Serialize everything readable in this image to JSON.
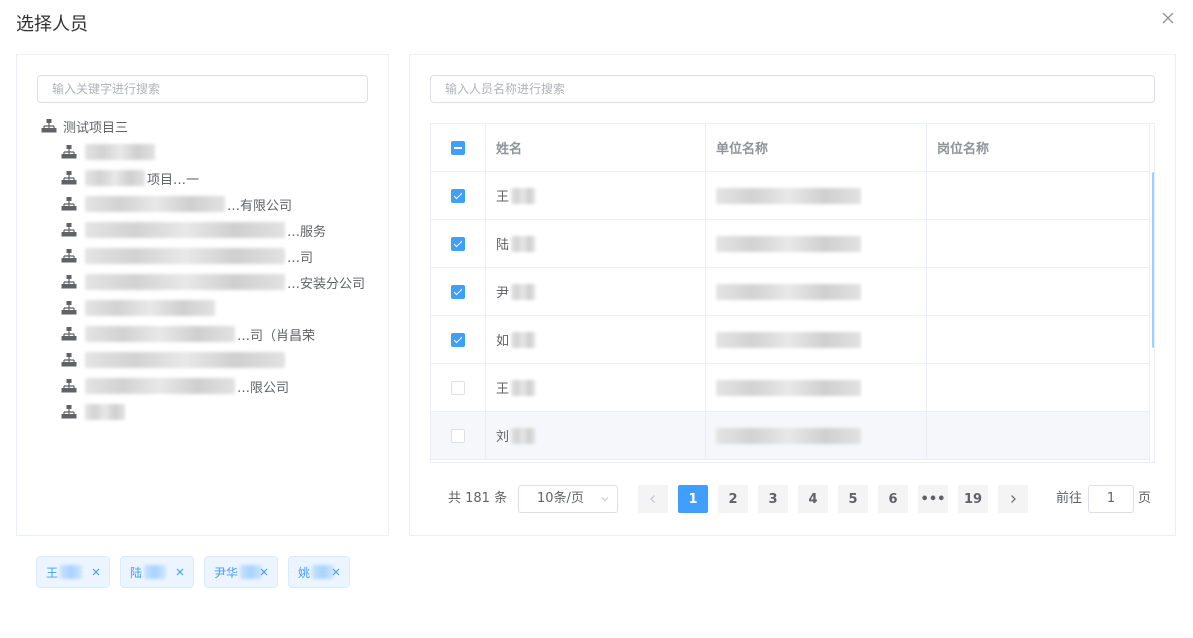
{
  "dialog": {
    "title": "选择人员"
  },
  "left": {
    "search_placeholder": "输入关键字进行搜索",
    "tree": {
      "root": "测试项目三",
      "children": [
        {
          "suffix": "",
          "blur": 70
        },
        {
          "suffix": "项目…一",
          "blur": 60
        },
        {
          "suffix": "…有限公司",
          "blur": 140
        },
        {
          "suffix": "…服务",
          "blur": 200
        },
        {
          "suffix": "…司",
          "blur": 215
        },
        {
          "suffix": "…安装分公司",
          "blur": 220
        },
        {
          "suffix": "",
          "blur": 130
        },
        {
          "suffix": "…司（肖昌荣",
          "blur": 150
        },
        {
          "suffix": "",
          "blur": 205
        },
        {
          "suffix": "…限公司",
          "blur": 150
        },
        {
          "suffix": "",
          "blur": 40
        }
      ]
    }
  },
  "right": {
    "search_placeholder": "输入人员名称进行搜索",
    "table": {
      "headers": [
        "姓名",
        "单位名称",
        "岗位名称"
      ],
      "rows": [
        {
          "name": "王",
          "checked": true
        },
        {
          "name": "陆",
          "checked": true
        },
        {
          "name": "尹",
          "checked": true
        },
        {
          "name": "如",
          "checked": true
        },
        {
          "name": "王",
          "checked": false
        },
        {
          "name": "刘",
          "checked": false
        }
      ]
    },
    "pagination": {
      "total": "共 181 条",
      "page_size": "10条/页",
      "pages": [
        "1",
        "2",
        "3",
        "4",
        "5",
        "6",
        "•••",
        "19"
      ],
      "current": "1",
      "goto_label": "前往",
      "goto_value": "1",
      "page_suffix": "页"
    }
  },
  "selected_tags": [
    {
      "label": "王"
    },
    {
      "label": "陆"
    },
    {
      "label": "尹华"
    },
    {
      "label": "姚"
    }
  ],
  "colors": {
    "primary": "#409eff",
    "border": "#ebeef5"
  }
}
